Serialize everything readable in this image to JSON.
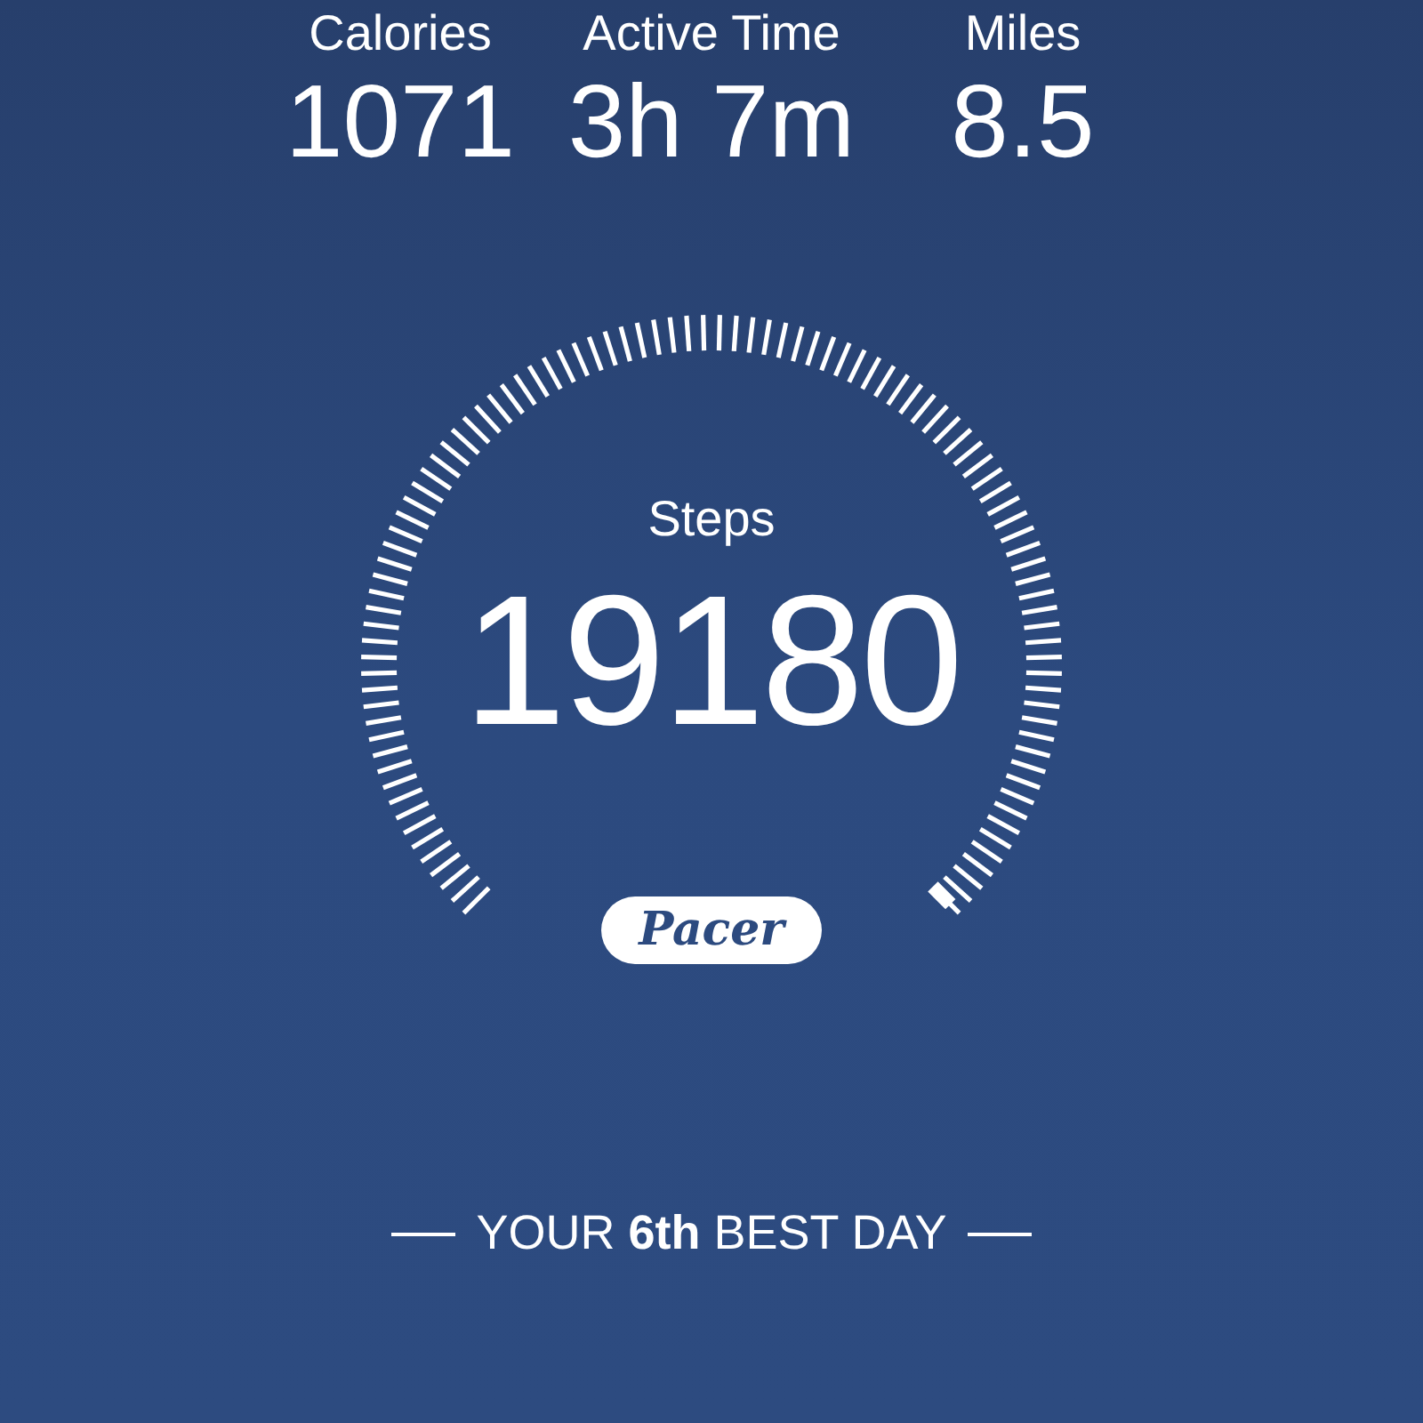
{
  "stats": [
    {
      "label": "Calories",
      "value": "1071"
    },
    {
      "label": "Active Time",
      "value": "3h 7m"
    },
    {
      "label": "Miles",
      "value": "8.5"
    }
  ],
  "gauge": {
    "label": "Steps",
    "value": "19180",
    "badge": "Pacer"
  },
  "footer": "YOUR **6th** BEST DAY"
}
